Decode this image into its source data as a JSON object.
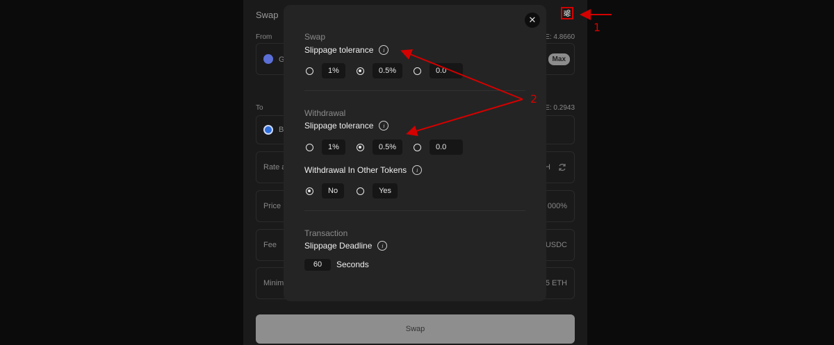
{
  "card": {
    "title": "Swap",
    "from_label": "From",
    "from_balance": "E: 4.8660",
    "from_token": "G",
    "max_label": "Max",
    "to_label": "To",
    "to_balance": "E: 0.2943",
    "to_token": "B",
    "rows": [
      {
        "label": "Rate a",
        "value": "H"
      },
      {
        "label": "Price I",
        "value": "000%"
      },
      {
        "label": "Fee",
        "value": "USDC"
      },
      {
        "label": "Minim",
        "value": "5 ETH"
      }
    ],
    "swap_button": "Swap"
  },
  "modal": {
    "swap_section": {
      "title": "Swap",
      "label": "Slippage tolerance",
      "options": [
        "1%",
        "0.5%",
        "0.0"
      ],
      "selected": "0.5%"
    },
    "withdrawal_section": {
      "title": "Withdrawal",
      "label": "Slippage tolerance",
      "options": [
        "1%",
        "0.5%",
        "0.0"
      ],
      "selected": "0.5%",
      "other_tokens_label": "Withdrawal In Other Tokens",
      "other_tokens_options": [
        "No",
        "Yes"
      ],
      "other_tokens_selected": "No"
    },
    "transaction_section": {
      "title": "Transaction",
      "label": "Slippage Deadline",
      "value": "60",
      "unit": "Seconds"
    }
  },
  "annotations": {
    "marker1": "1",
    "marker2": "2",
    "color": "#d40000"
  }
}
